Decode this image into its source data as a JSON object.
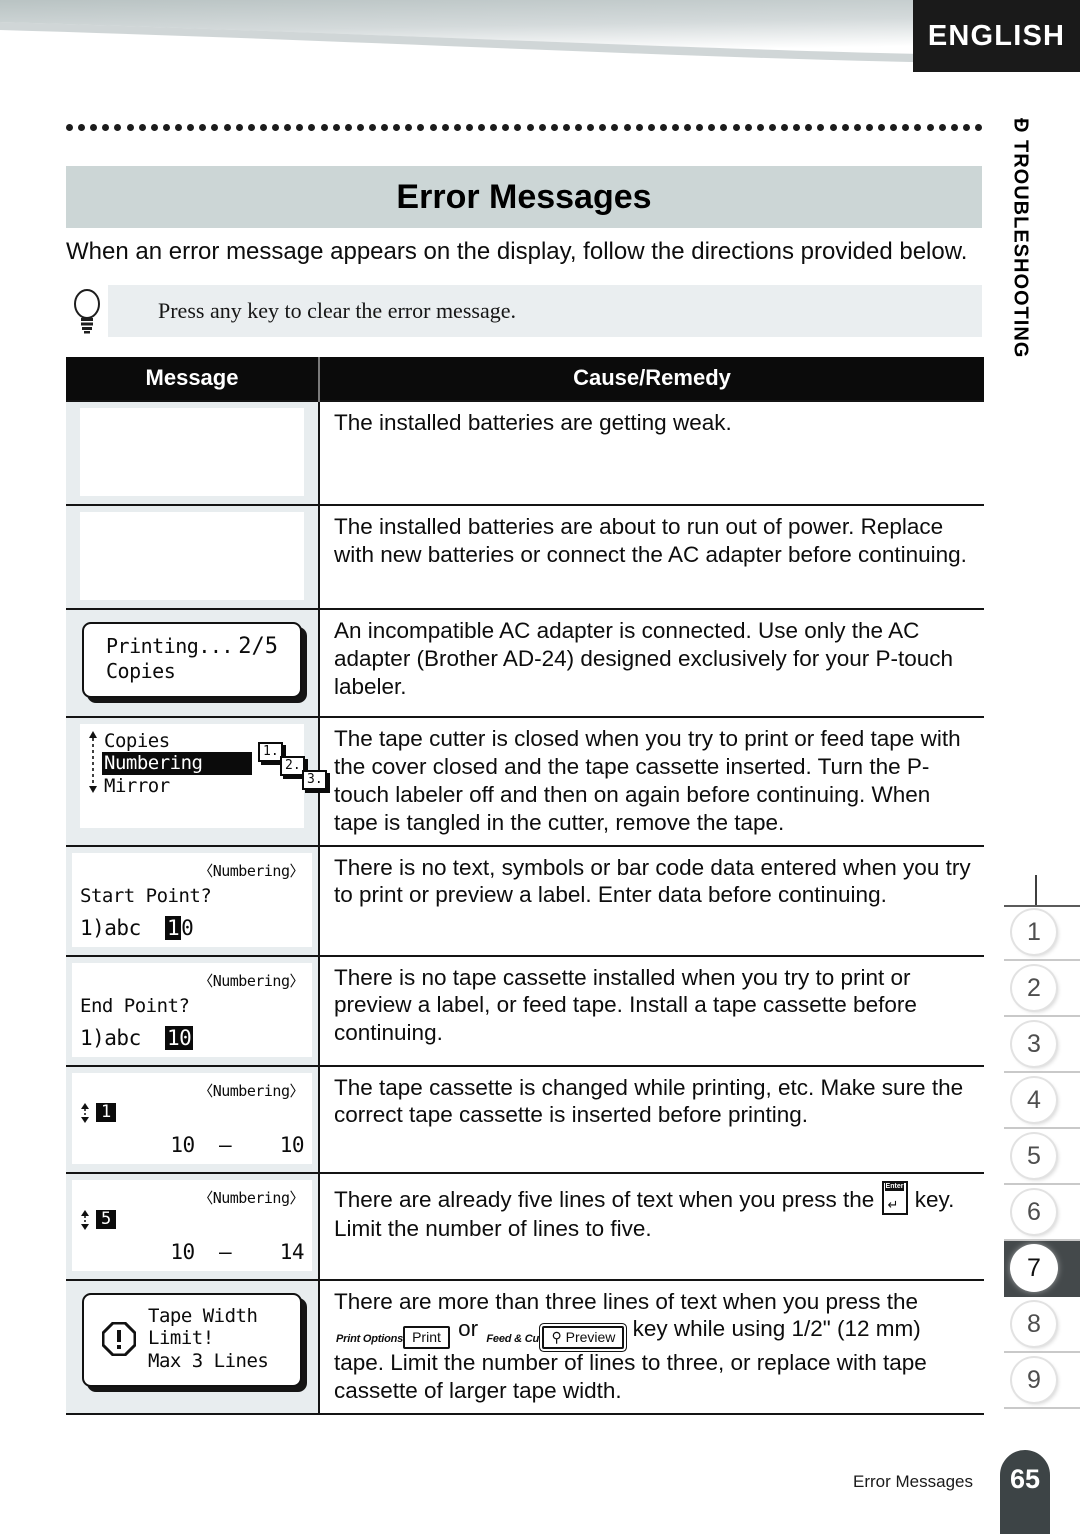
{
  "header": {
    "language_tab": "ENGLISH",
    "side_title": "Ð TROUBLESHOOTING"
  },
  "page": {
    "title": "Error Messages",
    "intro": "When an error message appears on the display, follow the directions provided below.",
    "tip": "Press any key to clear the error message."
  },
  "table": {
    "headers": {
      "message": "Message",
      "cause_remedy": "Cause/Remedy"
    },
    "rows": [
      {
        "lcd": {
          "kind": "blank"
        },
        "remedy": "The installed batteries are getting weak."
      },
      {
        "lcd": {
          "kind": "blank"
        },
        "remedy": "The installed batteries are about to run out of power. Replace with new batteries or connect the AC adapter before continuing."
      },
      {
        "lcd": {
          "kind": "print-dialog",
          "line1_left": "Printing...",
          "line1_right": "2/5",
          "line2_left": "Copies"
        },
        "remedy": "An incompatible AC adapter is connected. Use only the AC adapter (Brother AD-24) designed exclusively for your P-touch labeler."
      },
      {
        "lcd": {
          "kind": "menu",
          "items": [
            "Copies",
            "Numbering",
            "Mirror"
          ],
          "selected_index": 1,
          "page_boxes": [
            "1.",
            "2.",
            "3."
          ]
        },
        "remedy": "The tape cutter is closed when you try to print or feed tape with the cover closed and the tape cassette inserted. Turn the P-touch labeler off and then on again before continuing. When tape is tangled in the cutter, remove the tape."
      },
      {
        "lcd": {
          "kind": "point",
          "context": "〈Numbering〉",
          "prompt": "Start Point?",
          "value_prefix": "1)abc",
          "value_inverse": "1",
          "value_tail": "0"
        },
        "remedy": "There is no text, symbols or bar code data entered when you try to print or preview a label. Enter data before continuing."
      },
      {
        "lcd": {
          "kind": "point",
          "context": "〈Numbering〉",
          "prompt": "End Point?",
          "value_prefix": "1)abc",
          "value_inverse": "10",
          "value_tail": ""
        },
        "remedy": "There is no tape cassette installed when you try to print or preview a label, or feed tape. Install a tape cassette before continuing."
      },
      {
        "lcd": {
          "kind": "range",
          "context": "〈Numbering〉",
          "badge": "1",
          "range_left": "10",
          "range_dash": "–",
          "range_right": "10"
        },
        "remedy": "The tape cassette is changed while printing, etc. Make sure the correct tape cassette is inserted before printing."
      },
      {
        "lcd": {
          "kind": "range",
          "context": "〈Numbering〉",
          "badge": "5",
          "range_left": "10",
          "range_dash": "–",
          "range_right": "14"
        },
        "remedy_parts": {
          "before_key": "There are already five lines of text when you press the ",
          "after_key": " key. Limit the number of lines to five."
        }
      },
      {
        "lcd": {
          "kind": "tape-width",
          "line1": "Tape Width",
          "line2": "Limit!",
          "line3": "Max 3 Lines"
        },
        "remedy_parts": {
          "before_keys": "There are more than three lines of text when you press the ",
          "between_keys": " or ",
          "after_keys": " key while using 1/2\" (12 mm) tape. Limit the number of lines to three, or replace with tape cassette of larger tape width."
        }
      }
    ]
  },
  "keys": {
    "enter": {
      "cap": "Enter",
      "glyph": "↵"
    },
    "print": {
      "label": "Print Options",
      "name": "Print"
    },
    "preview": {
      "label": "Feed & Cut",
      "name": "Preview",
      "icon": "⚲"
    }
  },
  "index_rail": {
    "items": [
      "1",
      "2",
      "3",
      "4",
      "5",
      "6",
      "7",
      "8",
      "9"
    ],
    "active": "7"
  },
  "footer": {
    "section": "Error Messages",
    "page_number": "65"
  },
  "colors": {
    "title_band": "#ccd6d6",
    "header_black": "#0b0b0b",
    "msg_cell_bg": "#e8edef",
    "tip_bg": "#eaeef0",
    "rail_active": "#44494b",
    "footer_tab": "#3d4446"
  }
}
